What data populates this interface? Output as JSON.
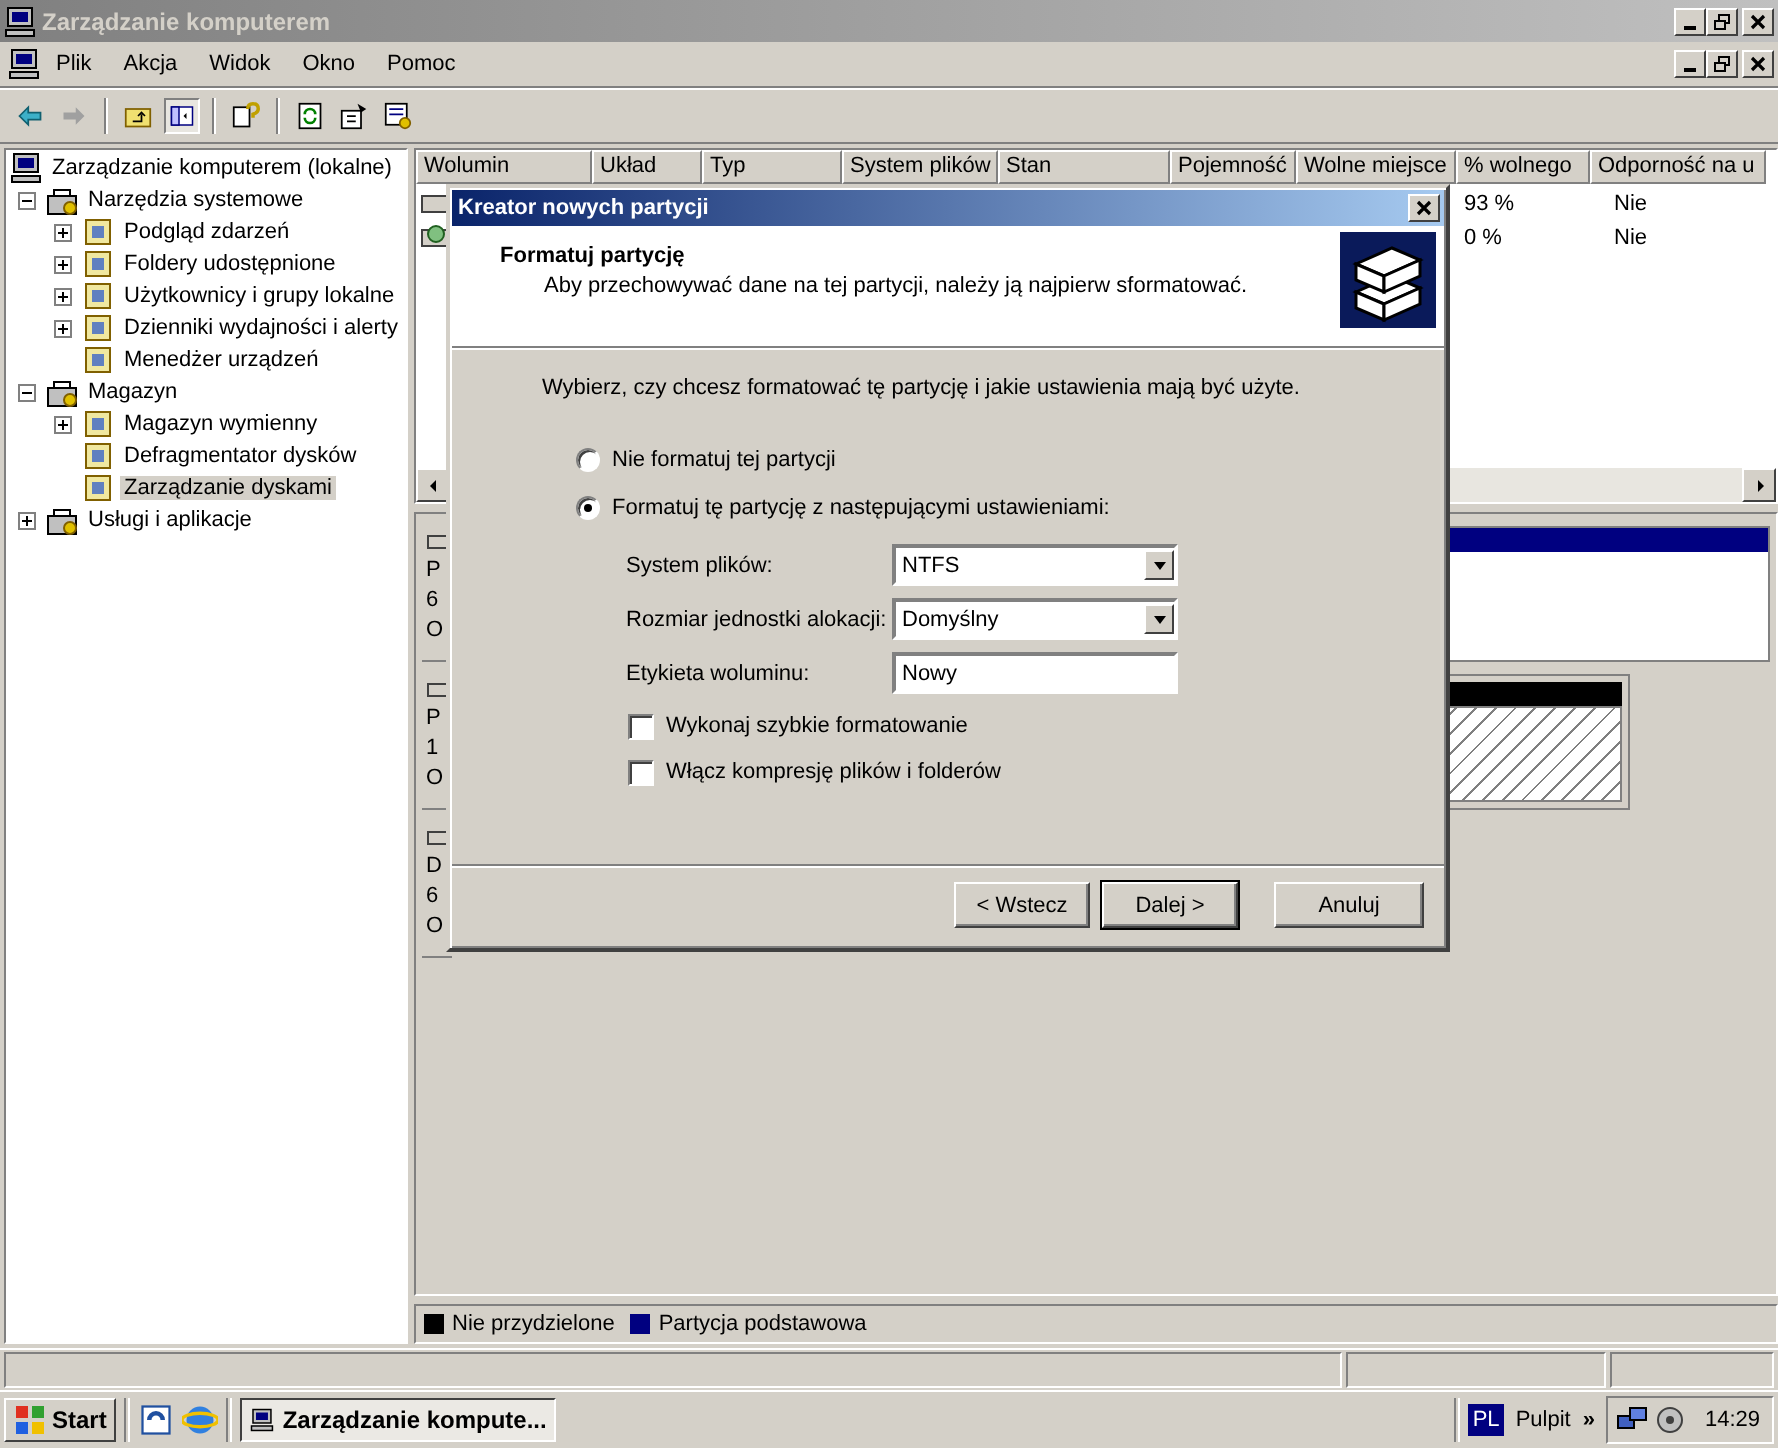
{
  "window": {
    "title": "Zarządzanie komputerem"
  },
  "menu": [
    "Plik",
    "Akcja",
    "Widok",
    "Okno",
    "Pomoc"
  ],
  "tree": [
    {
      "label": "Zarządzanie komputerem (lokalne)",
      "kind": "root",
      "selected": false,
      "children": [
        {
          "label": "Narzędzia systemowe",
          "kind": "branch",
          "expanded": true,
          "selected": false,
          "children": [
            {
              "label": "Podgląd zdarzeń",
              "kind": "branch",
              "expanded": false,
              "selected": false
            },
            {
              "label": "Foldery udostępnione",
              "kind": "branch",
              "expanded": false,
              "selected": false
            },
            {
              "label": "Użytkownicy i grupy lokalne",
              "kind": "branch",
              "expanded": false,
              "selected": false
            },
            {
              "label": "Dzienniki wydajności i alerty",
              "kind": "branch",
              "expanded": false,
              "selected": false
            },
            {
              "label": "Menedżer urządzeń",
              "kind": "leaf",
              "selected": false
            }
          ]
        },
        {
          "label": "Magazyn",
          "kind": "branch",
          "expanded": true,
          "selected": false,
          "children": [
            {
              "label": "Magazyn wymienny",
              "kind": "branch",
              "expanded": false,
              "selected": false
            },
            {
              "label": "Defragmentator dysków",
              "kind": "leaf",
              "selected": false
            },
            {
              "label": "Zarządzanie dyskami",
              "kind": "leaf",
              "selected": true
            }
          ]
        },
        {
          "label": "Usługi i aplikacje",
          "kind": "branch",
          "expanded": false,
          "selected": false
        }
      ]
    }
  ],
  "table": {
    "columns": [
      "Wolumin",
      "Układ",
      "Typ",
      "System plików",
      "Stan",
      "Pojemność",
      "Wolne miejsce",
      "% wolnego",
      "Odporność na u"
    ],
    "rows": [
      {
        "free_percent": "93 %",
        "column_9": "Nie"
      },
      {
        "free_percent": "0 %",
        "column_9": "Nie"
      }
    ]
  },
  "disks": [
    {
      "lines": [
        "P",
        "6",
        "O"
      ]
    },
    {
      "lines": [
        "P",
        "1",
        "O"
      ]
    },
    {
      "lines": [
        "D",
        "6",
        "O"
      ]
    }
  ],
  "legend": [
    {
      "label": "Nie przydzielone",
      "color": "#000000"
    },
    {
      "label": "Partycja podstawowa",
      "color": "#000080"
    }
  ],
  "dialog": {
    "title": "Kreator nowych partycji",
    "heading": "Formatuj partycję",
    "subheading": "Aby przechowywać dane na tej partycji, należy ją najpierw sformatować.",
    "intro": "Wybierz, czy chcesz formatować tę partycję i jakie ustawienia mają być użyte.",
    "radios": [
      {
        "label": "Nie formatuj tej partycji",
        "selected": false
      },
      {
        "label": "Formatuj tę partycję z następującymi ustawieniami:",
        "selected": true
      }
    ],
    "fields": [
      {
        "label": "System plików:",
        "kind": "select",
        "value": "NTFS"
      },
      {
        "label": "Rozmiar jednostki alokacji:",
        "kind": "select",
        "value": "Domyślny"
      },
      {
        "label": "Etykieta woluminu:",
        "kind": "text",
        "value": "Nowy"
      }
    ],
    "checkboxes": [
      {
        "label": "Wykonaj szybkie formatowanie",
        "checked": false
      },
      {
        "label": "Włącz kompresję plików i folderów",
        "checked": false
      }
    ],
    "buttons": [
      {
        "label": "< Wstecz",
        "default": false
      },
      {
        "label": "Dalej >",
        "default": true
      },
      {
        "label": "Anuluj",
        "default": false
      }
    ]
  },
  "taskbar": {
    "start": "Start",
    "task": "Zarządzanie kompute...",
    "language": "PL",
    "toolbar": "Pulpit",
    "chevron": "»",
    "clock": "14:29"
  }
}
